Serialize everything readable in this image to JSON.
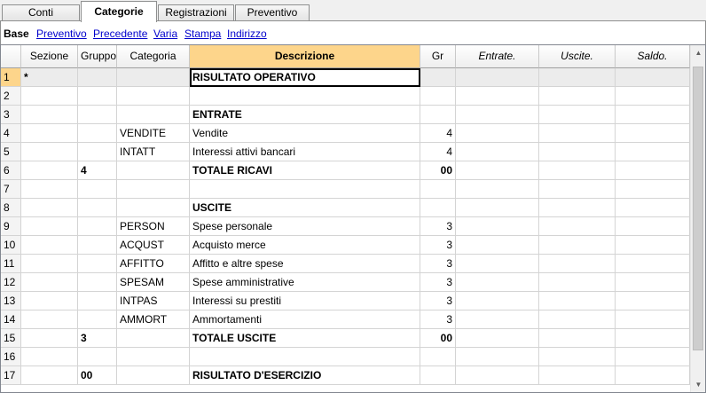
{
  "tabs": [
    {
      "label": "Conti",
      "active": false
    },
    {
      "label": "Categorie",
      "active": true
    },
    {
      "label": "Registrazioni",
      "active": false
    },
    {
      "label": "Preventivo",
      "active": false
    }
  ],
  "views": {
    "base": "Base",
    "links": [
      "Preventivo",
      "Precedente",
      "Varia",
      "Stampa",
      "Indirizzo"
    ]
  },
  "columns": [
    "",
    "Sezione",
    "Gruppo",
    "Categoria",
    "Descrizione",
    "Gr",
    "Entrate.",
    "Uscite.",
    "Saldo."
  ],
  "rows": [
    {
      "n": "1",
      "sezione": "*",
      "gruppo": "",
      "categoria": "",
      "descrizione": "RISULTATO OPERATIVO",
      "gr": "",
      "bold": true
    },
    {
      "n": "2",
      "sezione": "",
      "gruppo": "",
      "categoria": "",
      "descrizione": "",
      "gr": "",
      "bold": false
    },
    {
      "n": "3",
      "sezione": "",
      "gruppo": "",
      "categoria": "",
      "descrizione": "ENTRATE",
      "gr": "",
      "bold": true
    },
    {
      "n": "4",
      "sezione": "",
      "gruppo": "",
      "categoria": "VENDITE",
      "descrizione": "Vendite",
      "gr": "4",
      "bold": false
    },
    {
      "n": "5",
      "sezione": "",
      "gruppo": "",
      "categoria": "INTATT",
      "descrizione": "Interessi attivi bancari",
      "gr": "4",
      "bold": false
    },
    {
      "n": "6",
      "sezione": "",
      "gruppo": "4",
      "categoria": "",
      "descrizione": "TOTALE RICAVI",
      "gr": "00",
      "bold": true
    },
    {
      "n": "7",
      "sezione": "",
      "gruppo": "",
      "categoria": "",
      "descrizione": "",
      "gr": "",
      "bold": false
    },
    {
      "n": "8",
      "sezione": "",
      "gruppo": "",
      "categoria": "",
      "descrizione": "USCITE",
      "gr": "",
      "bold": true
    },
    {
      "n": "9",
      "sezione": "",
      "gruppo": "",
      "categoria": "PERSON",
      "descrizione": "Spese personale",
      "gr": "3",
      "bold": false
    },
    {
      "n": "10",
      "sezione": "",
      "gruppo": "",
      "categoria": "ACQUST",
      "descrizione": "Acquisto merce",
      "gr": "3",
      "bold": false
    },
    {
      "n": "11",
      "sezione": "",
      "gruppo": "",
      "categoria": "AFFITTO",
      "descrizione": "Affitto e altre spese",
      "gr": "3",
      "bold": false
    },
    {
      "n": "12",
      "sezione": "",
      "gruppo": "",
      "categoria": "SPESAM",
      "descrizione": "Spese amministrative",
      "gr": "3",
      "bold": false
    },
    {
      "n": "13",
      "sezione": "",
      "gruppo": "",
      "categoria": "INTPAS",
      "descrizione": "Interessi su prestiti",
      "gr": "3",
      "bold": false
    },
    {
      "n": "14",
      "sezione": "",
      "gruppo": "",
      "categoria": "AMMORT",
      "descrizione": "Ammortamenti",
      "gr": "3",
      "bold": false
    },
    {
      "n": "15",
      "sezione": "",
      "gruppo": "3",
      "categoria": "",
      "descrizione": "TOTALE USCITE",
      "gr": "00",
      "bold": true
    },
    {
      "n": "16",
      "sezione": "",
      "gruppo": "",
      "categoria": "",
      "descrizione": "",
      "gr": "",
      "bold": false
    },
    {
      "n": "17",
      "sezione": "",
      "gruppo": "00",
      "categoria": "",
      "descrizione": "RISULTATO D'ESERCIZIO",
      "gr": "",
      "bold": true
    }
  ],
  "colors": {
    "accent": "#fdd58b",
    "link": "#0000cc"
  }
}
